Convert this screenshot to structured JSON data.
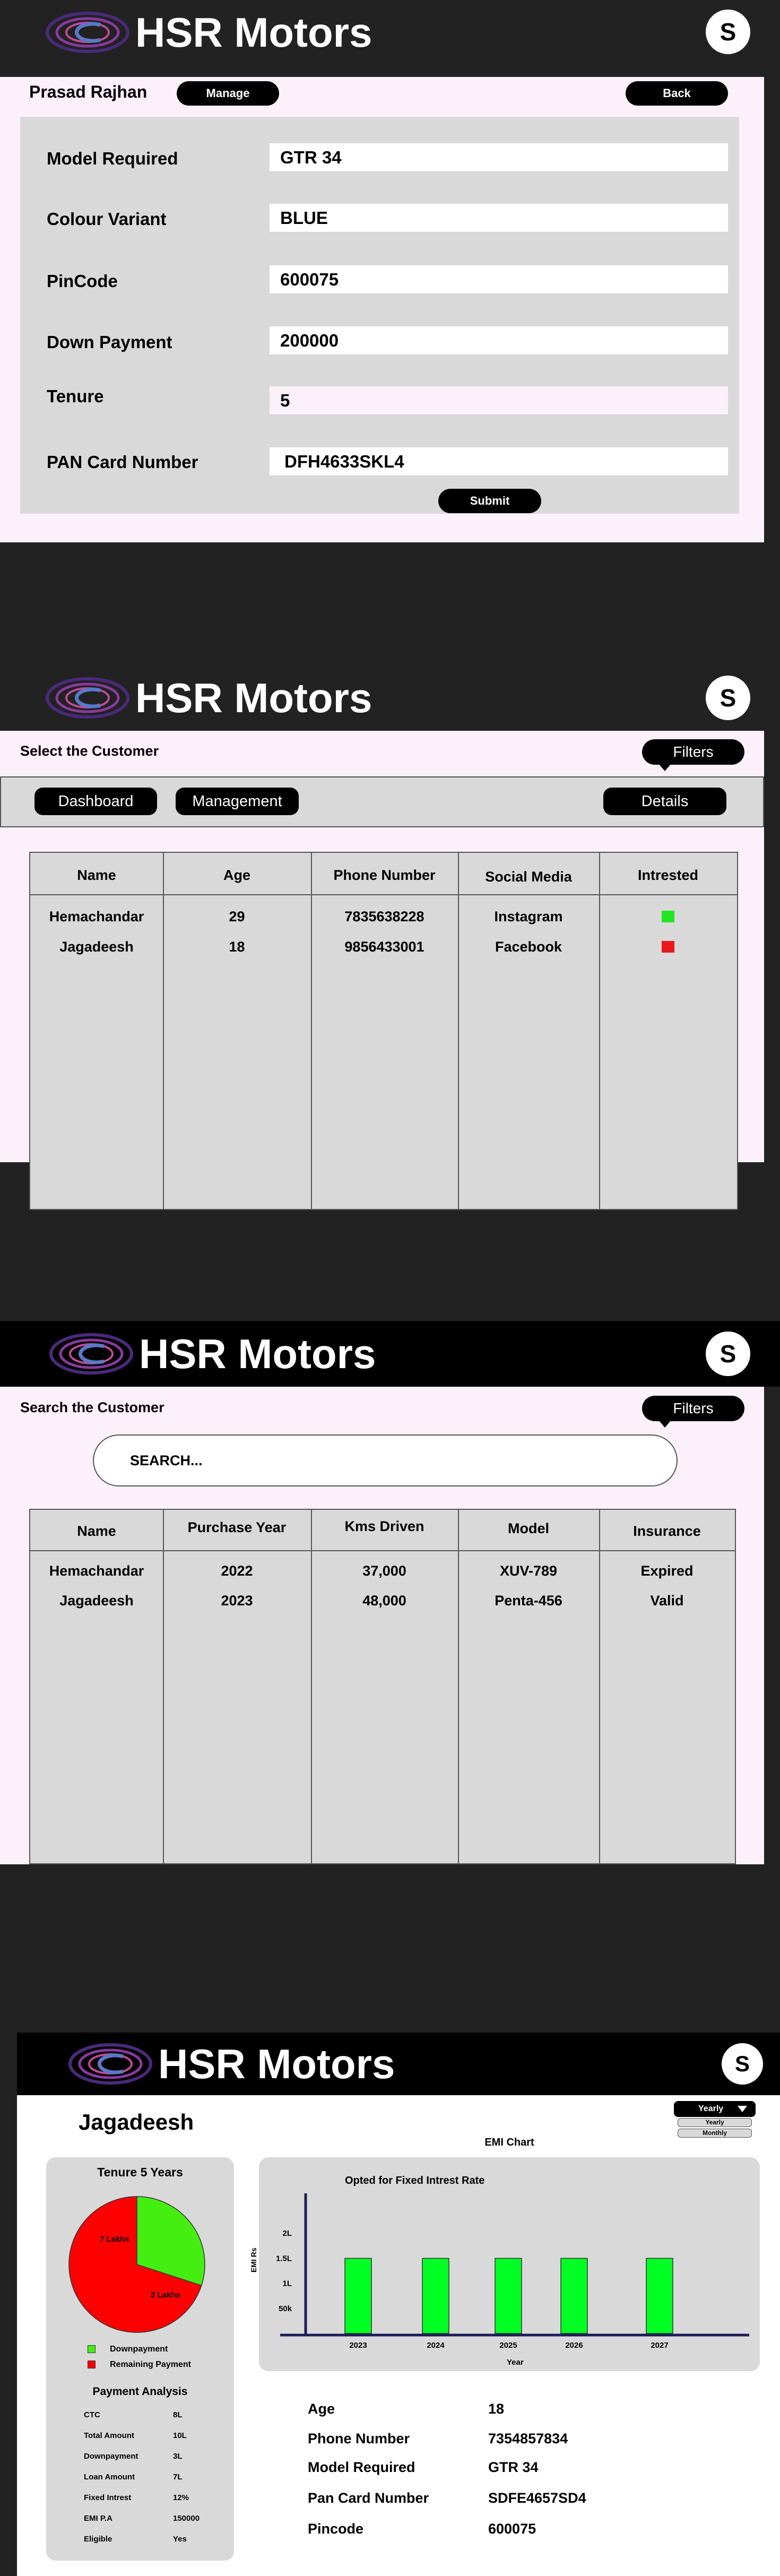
{
  "brand": {
    "name": "HSR Motors",
    "avatar_initial": "S"
  },
  "order_form": {
    "customer_name": "Prasad Rajhan",
    "manage_label": "Manage",
    "back_label": "Back",
    "fields": [
      {
        "label": "Model Required",
        "value": "GTR 34"
      },
      {
        "label": "Colour Variant",
        "value": "BLUE"
      },
      {
        "label": "PinCode",
        "value": "600075"
      },
      {
        "label": "Down Payment",
        "value": "200000"
      },
      {
        "label": "Tenure",
        "value": "5"
      },
      {
        "label": "PAN Card Number",
        "value": "DFH4633SKL4"
      }
    ],
    "submit_label": "Submit"
  },
  "select_customer": {
    "title": "Select the Customer",
    "filters_label": "Filters",
    "nav": {
      "dashboard": "Dashboard",
      "management": "Management",
      "details": "Details"
    },
    "headers": [
      "Name",
      "Age",
      "Phone Number",
      "Social Media",
      "Intrested"
    ],
    "rows": [
      {
        "name": "Hemachandar",
        "age": "29",
        "phone": "7835638228",
        "social": "Instagram",
        "interested_color": "#22e622"
      },
      {
        "name": "Jagadeesh",
        "age": "18",
        "phone": "9856433001",
        "social": "Facebook",
        "interested_color": "#e61a1a"
      }
    ]
  },
  "search_customer": {
    "title": "Search the Customer",
    "filters_label": "Filters",
    "search_placeholder": "SEARCH...",
    "headers": [
      "Name",
      "Purchase Year",
      "Kms Driven",
      "Model",
      "Insurance"
    ],
    "rows": [
      {
        "name": "Hemachandar",
        "year": "2022",
        "kms": "37,000",
        "model": "XUV-789",
        "insurance": "Expired"
      },
      {
        "name": "Jagadeesh",
        "year": "2023",
        "kms": "48,000",
        "model": "Penta-456",
        "insurance": "Valid"
      }
    ]
  },
  "details": {
    "customer_name": "Jagadeesh",
    "period_select": {
      "selected": "Yearly",
      "options": [
        "Yearly",
        "Monthly"
      ]
    },
    "tenure_title": "Tenure 5 Years",
    "pie": {
      "slices": [
        {
          "label": "7 Lakhs",
          "value": 7,
          "color": "#ff0000"
        },
        {
          "label": "3 Lakhs",
          "value": 3,
          "color": "#44ee11"
        }
      ],
      "legend": [
        {
          "label": "Downpayment",
          "color": "#44ee11"
        },
        {
          "label": "Remaining Payment",
          "color": "#ff0000"
        }
      ]
    },
    "payment_title": "Payment Analysis",
    "payment_rows": [
      {
        "k": "CTC",
        "v": "8L"
      },
      {
        "k": "Total Amount",
        "v": "10L"
      },
      {
        "k": "Downpayment",
        "v": "3L"
      },
      {
        "k": "Loan Amount",
        "v": "7L"
      },
      {
        "k": "Fixed Intrest",
        "v": "12%"
      },
      {
        "k": "EMI P.A",
        "v": "150000"
      },
      {
        "k": "Eligible",
        "v": "Yes"
      }
    ],
    "info": [
      {
        "k": "Age",
        "v": "18"
      },
      {
        "k": "Phone Number",
        "v": "7354857834"
      },
      {
        "k": "Model Required",
        "v": "GTR 34"
      },
      {
        "k": "Pan Card Number",
        "v": "SDFE4657SD4"
      },
      {
        "k": "Pincode",
        "v": "600075"
      }
    ]
  },
  "chart_data": {
    "type": "bar",
    "title": "EMI Chart",
    "subtitle": "Opted for Fixed Intrest Rate",
    "xlabel": "Year",
    "ylabel": "EMI Rs",
    "categories": [
      "2023",
      "2024",
      "2025",
      "2026",
      "2027"
    ],
    "values": [
      150000,
      150000,
      150000,
      150000,
      150000
    ],
    "y_ticks": [
      {
        "v": 50000,
        "label": "50k"
      },
      {
        "v": 100000,
        "label": "1L"
      },
      {
        "v": 150000,
        "label": "1.5L"
      },
      {
        "v": 200000,
        "label": "2L"
      }
    ],
    "ylim": [
      0,
      250000
    ],
    "color": "#00ff22"
  }
}
